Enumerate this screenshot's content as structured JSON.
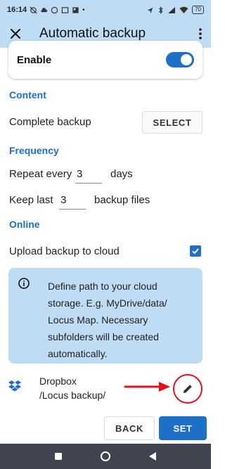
{
  "status_bar": {
    "time": "16:14",
    "battery": "70"
  },
  "app_bar": {
    "title": "Automatic backup"
  },
  "enable": {
    "label": "Enable",
    "checked": true
  },
  "content": {
    "heading": "Content",
    "complete_backup_label": "Complete backup",
    "select_label": "SELECT"
  },
  "frequency": {
    "heading": "Frequency",
    "repeat_prefix": "Repeat every",
    "repeat_value": "3",
    "repeat_suffix": "days",
    "keep_prefix": "Keep last",
    "keep_value": "3",
    "keep_suffix": "backup files"
  },
  "online": {
    "heading": "Online",
    "upload_label": "Upload backup to cloud",
    "upload_checked": true,
    "info_text": "Define path to your cloud storage. E.g. MyDrive/data/ Locus Map. Necessary subfolders will be created automatically."
  },
  "dropbox": {
    "name": "Dropbox",
    "path": "/Locus backup/"
  },
  "footer": {
    "back_label": "BACK",
    "set_label": "SET"
  },
  "colors": {
    "accent": "#1e6fc8",
    "header_bg": "#bfdcf5",
    "annotation_red": "#e0131d",
    "nav_bg": "#3f4450"
  }
}
